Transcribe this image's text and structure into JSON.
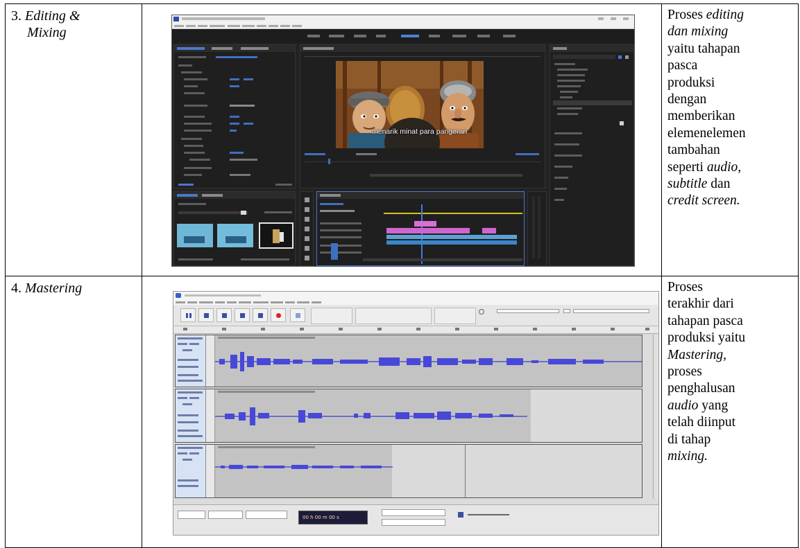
{
  "rows": [
    {
      "stage_number": "3.",
      "stage_name_line1": "Editing &",
      "stage_name_line2": "Mixing",
      "description": [
        [
          {
            "t": "Proses ",
            "i": false
          },
          {
            "t": "editing",
            "i": true
          }
        ],
        [
          {
            "t": "dan mixing",
            "i": true
          }
        ],
        [
          {
            "t": "yaitu tahapan",
            "i": false
          }
        ],
        [
          {
            "t": "pasca",
            "i": false
          }
        ],
        [
          {
            "t": "produksi",
            "i": false
          }
        ],
        [
          {
            "t": "dengan",
            "i": false
          }
        ],
        [
          {
            "t": "memberikan",
            "i": false
          }
        ],
        [
          {
            "t": "elemenelemen",
            "i": false
          }
        ],
        [
          {
            "t": "tambahan",
            "i": false
          }
        ],
        [
          {
            "t": "seperti ",
            "i": false
          },
          {
            "t": "audio,",
            "i": true
          }
        ],
        [
          {
            "t": "subtitle",
            "i": true
          },
          {
            "t": " dan",
            "i": false
          }
        ],
        [
          {
            "t": "credit screen.",
            "i": true
          }
        ]
      ],
      "screenshot": {
        "subtitle_text": "menarik minat para pangeran"
      }
    },
    {
      "stage_number": "4.",
      "stage_name": "Mastering",
      "description": [
        [
          {
            "t": "Proses",
            "i": false
          }
        ],
        [
          {
            "t": "terakhir dari",
            "i": false
          }
        ],
        [
          {
            "t": "tahapan pasca",
            "i": false
          }
        ],
        [
          {
            "t": "produksi yaitu",
            "i": false
          }
        ],
        [
          {
            "t": "Mastering,",
            "i": true
          }
        ],
        [
          {
            "t": "proses",
            "i": false
          }
        ],
        [
          {
            "t": "penghalusan",
            "i": false
          }
        ],
        [
          {
            "t": "audio",
            "i": true
          },
          {
            "t": " yang",
            "i": false
          }
        ],
        [
          {
            "t": "telah diinput",
            "i": false
          }
        ],
        [
          {
            "t": "di tahap",
            "i": false
          }
        ],
        [
          {
            "t": "mixing.",
            "i": true
          }
        ]
      ],
      "screenshot": {
        "time_display": "00 h 00 m 00 s"
      }
    }
  ]
}
